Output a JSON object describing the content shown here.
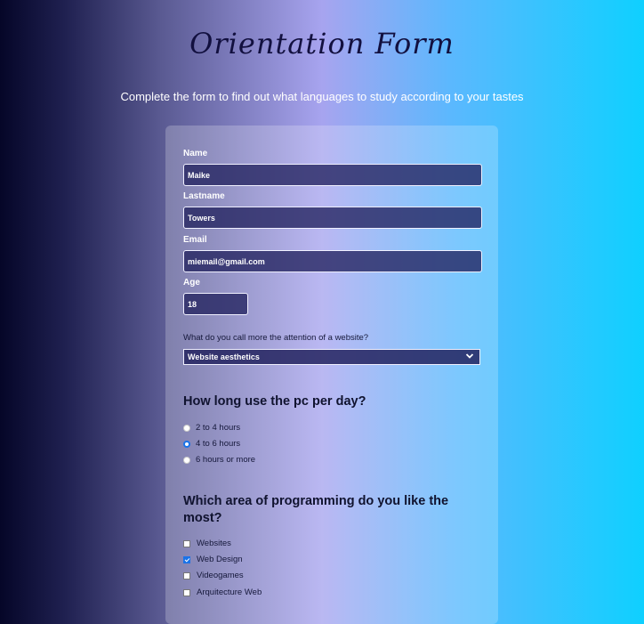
{
  "page": {
    "title": "Orientation Form",
    "subtitle": "Complete the form to find out what languages to study according to your tastes"
  },
  "form": {
    "name": {
      "label": "Name",
      "value": "Maike"
    },
    "lastname": {
      "label": "Lastname",
      "value": "Towers"
    },
    "email": {
      "label": "Email",
      "value": "miemail@gmail.com"
    },
    "age": {
      "label": "Age",
      "value": "18"
    },
    "attention": {
      "label": "What do you call more the attention of a website?",
      "selected": "Website aesthetics"
    },
    "pc_usage": {
      "heading": "How long use the pc per day?",
      "options": [
        {
          "label": "2 to 4 hours",
          "checked": false
        },
        {
          "label": "4 to 6 hours",
          "checked": true
        },
        {
          "label": "6 hours or more",
          "checked": false
        }
      ]
    },
    "programming_area": {
      "heading": "Which area of programming do you like the most?",
      "options": [
        {
          "label": "Websites",
          "checked": false
        },
        {
          "label": "Web Design",
          "checked": true
        },
        {
          "label": "Videogames",
          "checked": false
        },
        {
          "label": "Arquitecture Web",
          "checked": false
        }
      ]
    }
  },
  "colors": {
    "accent": "#1a73e8",
    "input_bg": "#2b2b6a",
    "title": "#12103f"
  }
}
